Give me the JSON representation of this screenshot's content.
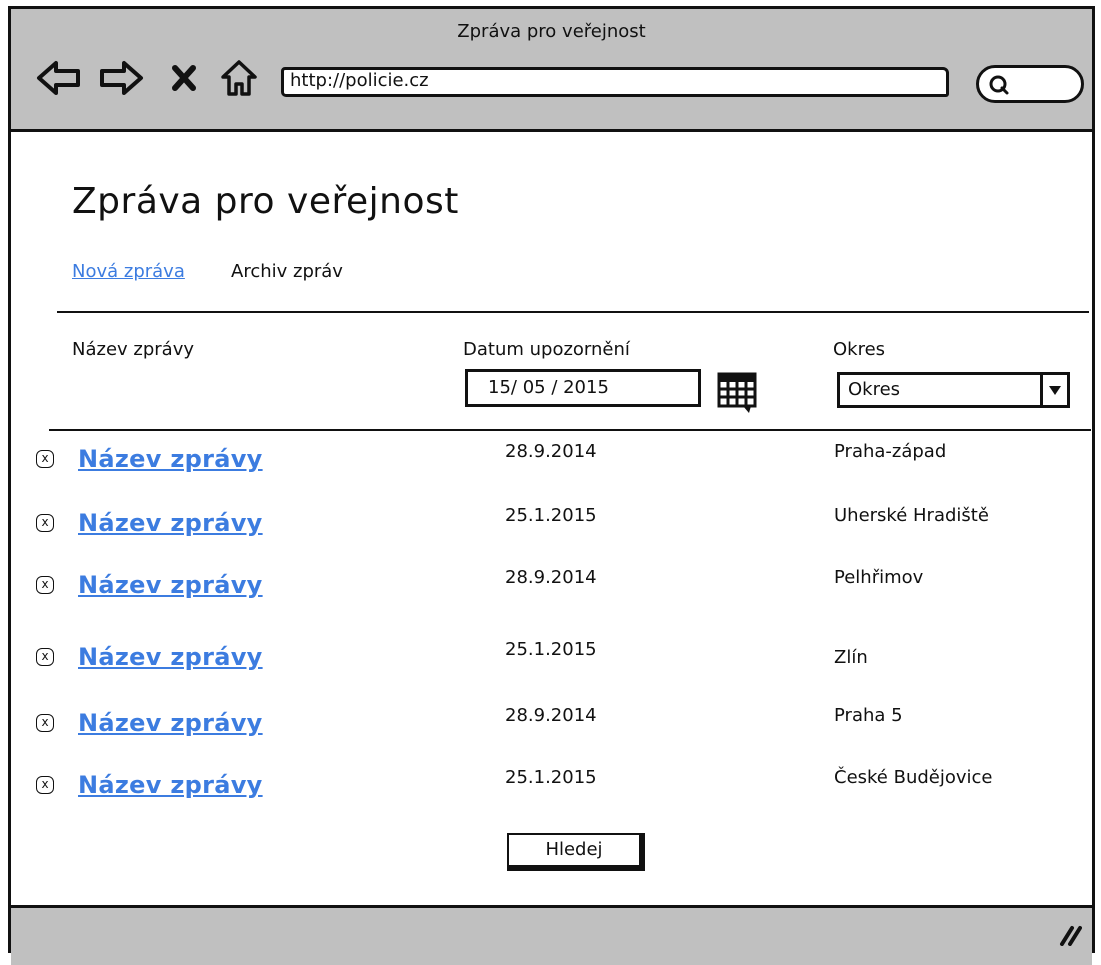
{
  "window": {
    "title": "Zpráva pro veřejnost",
    "url": "http://policie.cz"
  },
  "page": {
    "title": "Zpráva pro veřejnost",
    "tabs": {
      "new": "Nová zpráva",
      "archive": "Archiv zpráv"
    }
  },
  "filters": {
    "name_label": "Název zprávy",
    "date_label": "Datum upozornění",
    "date_value": "15/ 05 / 2015",
    "okres_label": "Okres",
    "okres_selected": "Okres"
  },
  "rows": [
    {
      "title": "Název zprávy",
      "date": "28.9.2014",
      "okres": "Praha-západ"
    },
    {
      "title": "Název zprávy",
      "date": "25.1.2015",
      "okres": "Uherské Hradiště"
    },
    {
      "title": "Název zprávy",
      "date": "28.9.2014",
      "okres": "Pelhřimov"
    },
    {
      "title": "Název zprávy",
      "date": "25.1.2015",
      "okres": "Zlín"
    },
    {
      "title": "Název zprávy",
      "date": "28.9.2014",
      "okres": "Praha 5"
    },
    {
      "title": "Název zprávy",
      "date": "25.1.2015",
      "okres": "České Budějovice"
    }
  ],
  "actions": {
    "search_label": "Hledej"
  },
  "icons": {
    "remove": "x",
    "accent_color": "#3c7ce0"
  }
}
